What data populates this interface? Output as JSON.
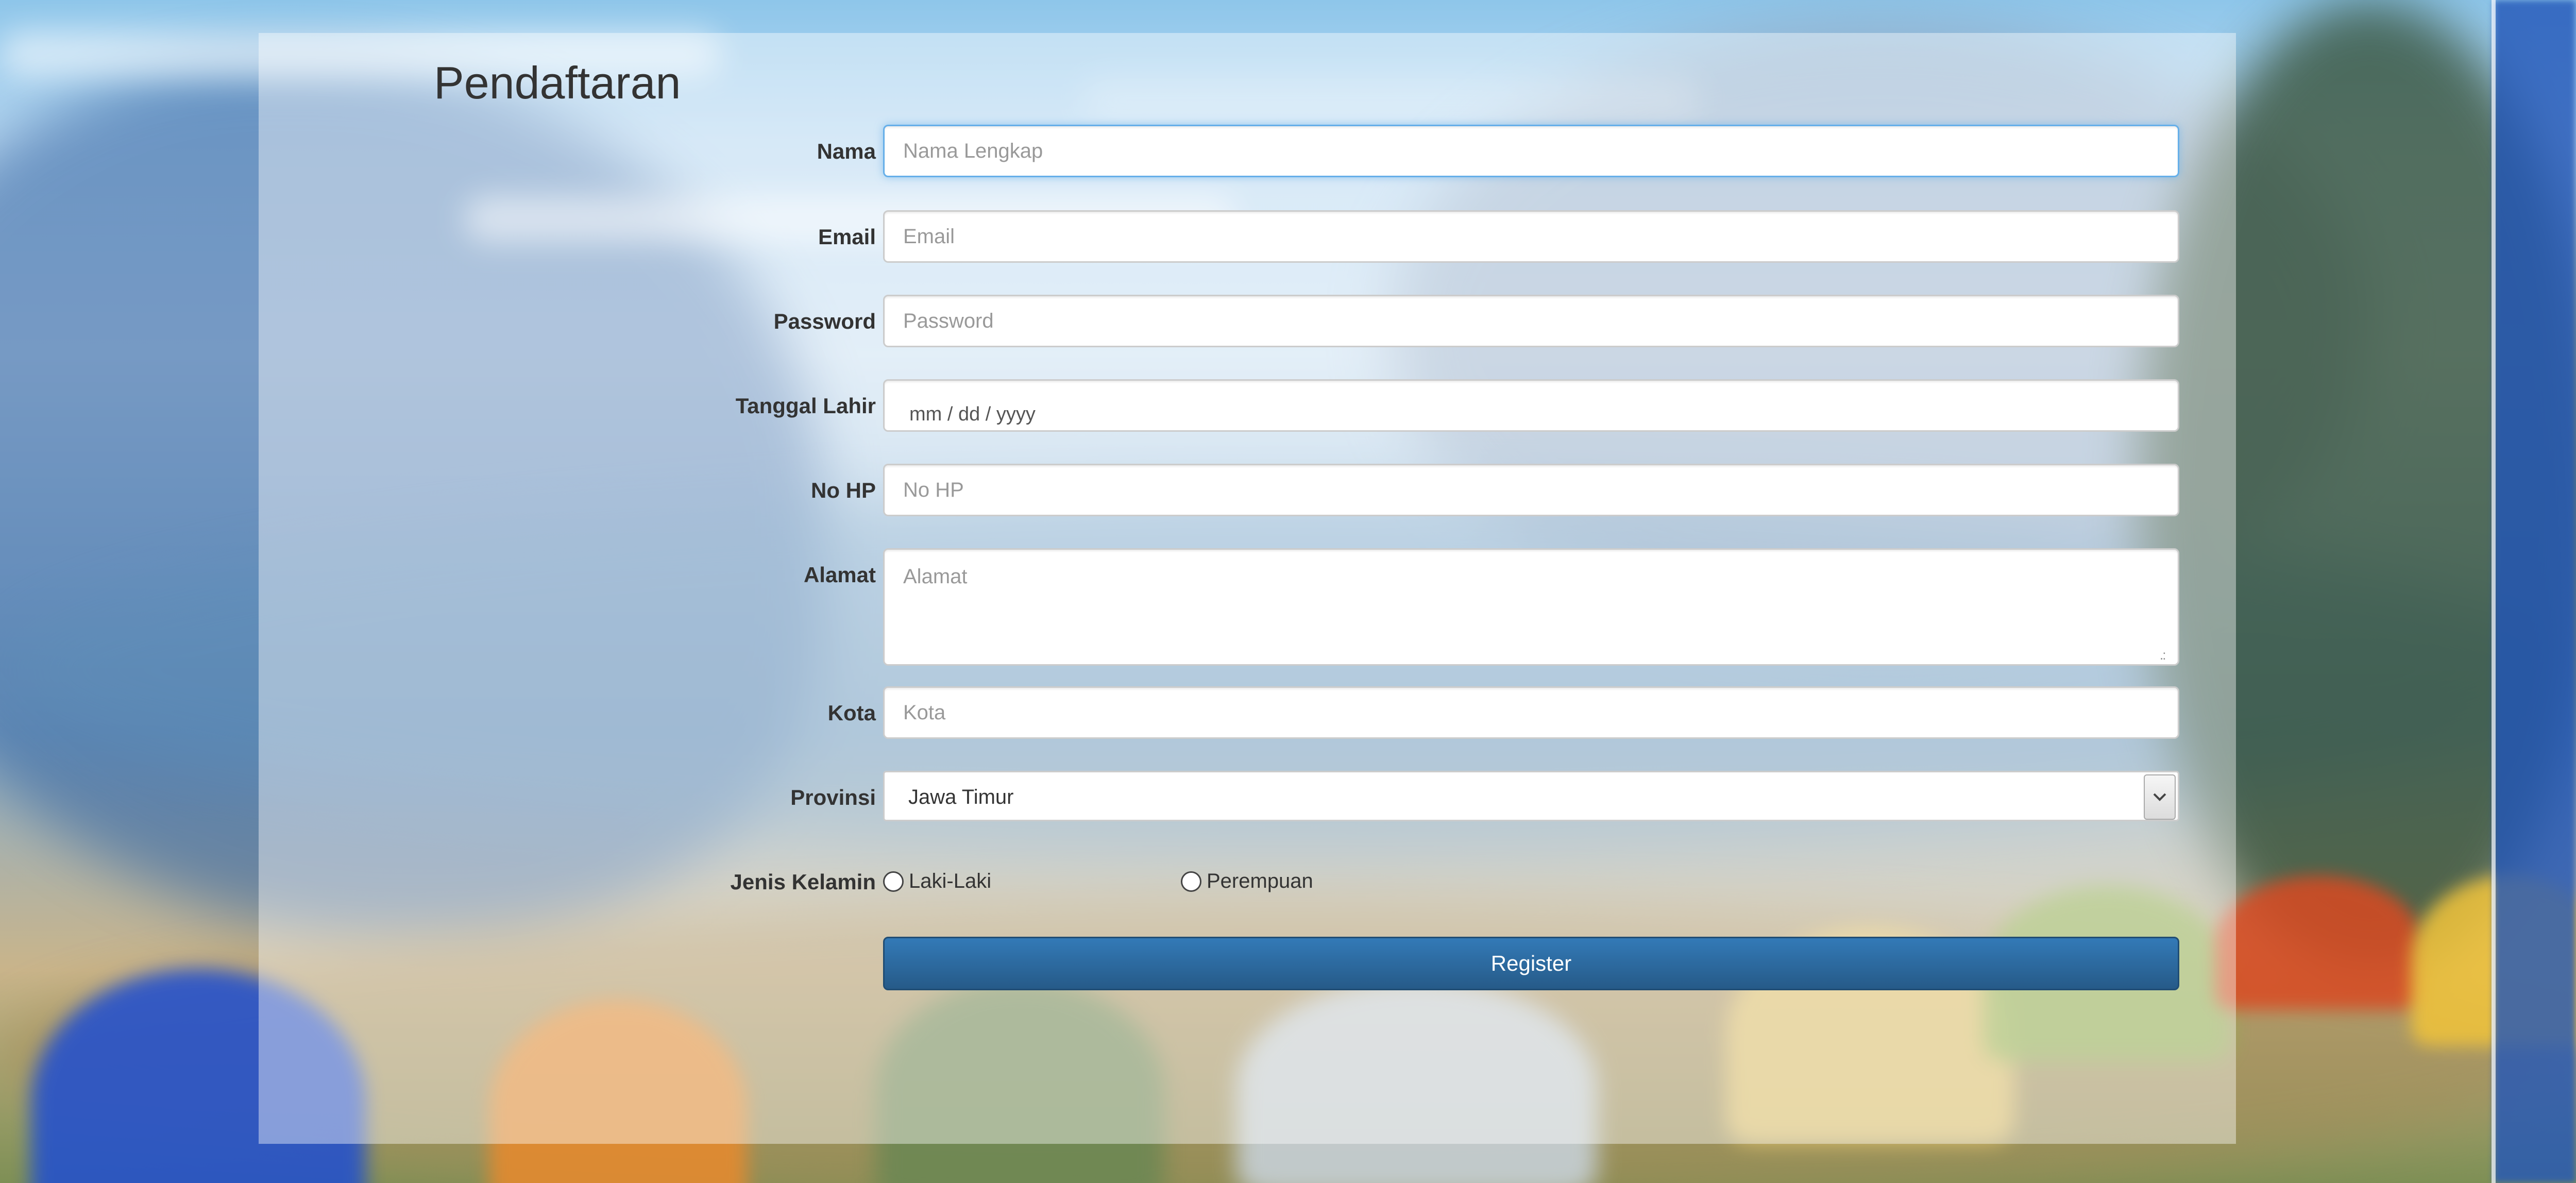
{
  "page": {
    "title": "Pendaftaran"
  },
  "form": {
    "nama": {
      "label": "Nama",
      "placeholder": "Nama Lengkap",
      "value": ""
    },
    "email": {
      "label": "Email",
      "placeholder": "Email",
      "value": ""
    },
    "password": {
      "label": "Password",
      "placeholder": "Password",
      "value": ""
    },
    "tanggal_lahir": {
      "label": "Tanggal Lahir",
      "placeholder": "mm / dd / yyyy",
      "value": ""
    },
    "no_hp": {
      "label": "No HP",
      "placeholder": "No HP",
      "value": ""
    },
    "alamat": {
      "label": "Alamat",
      "placeholder": "Alamat",
      "value": ""
    },
    "kota": {
      "label": "Kota",
      "placeholder": "Kota",
      "value": ""
    },
    "provinsi": {
      "label": "Provinsi",
      "selected": "Jawa Timur"
    },
    "jenis_kelamin": {
      "label": "Jenis Kelamin",
      "options": [
        "Laki-Laki",
        "Perempuan"
      ]
    },
    "register_label": "Register"
  },
  "colors": {
    "primary_button": "#337ab7",
    "focus_border": "#66afe9"
  }
}
